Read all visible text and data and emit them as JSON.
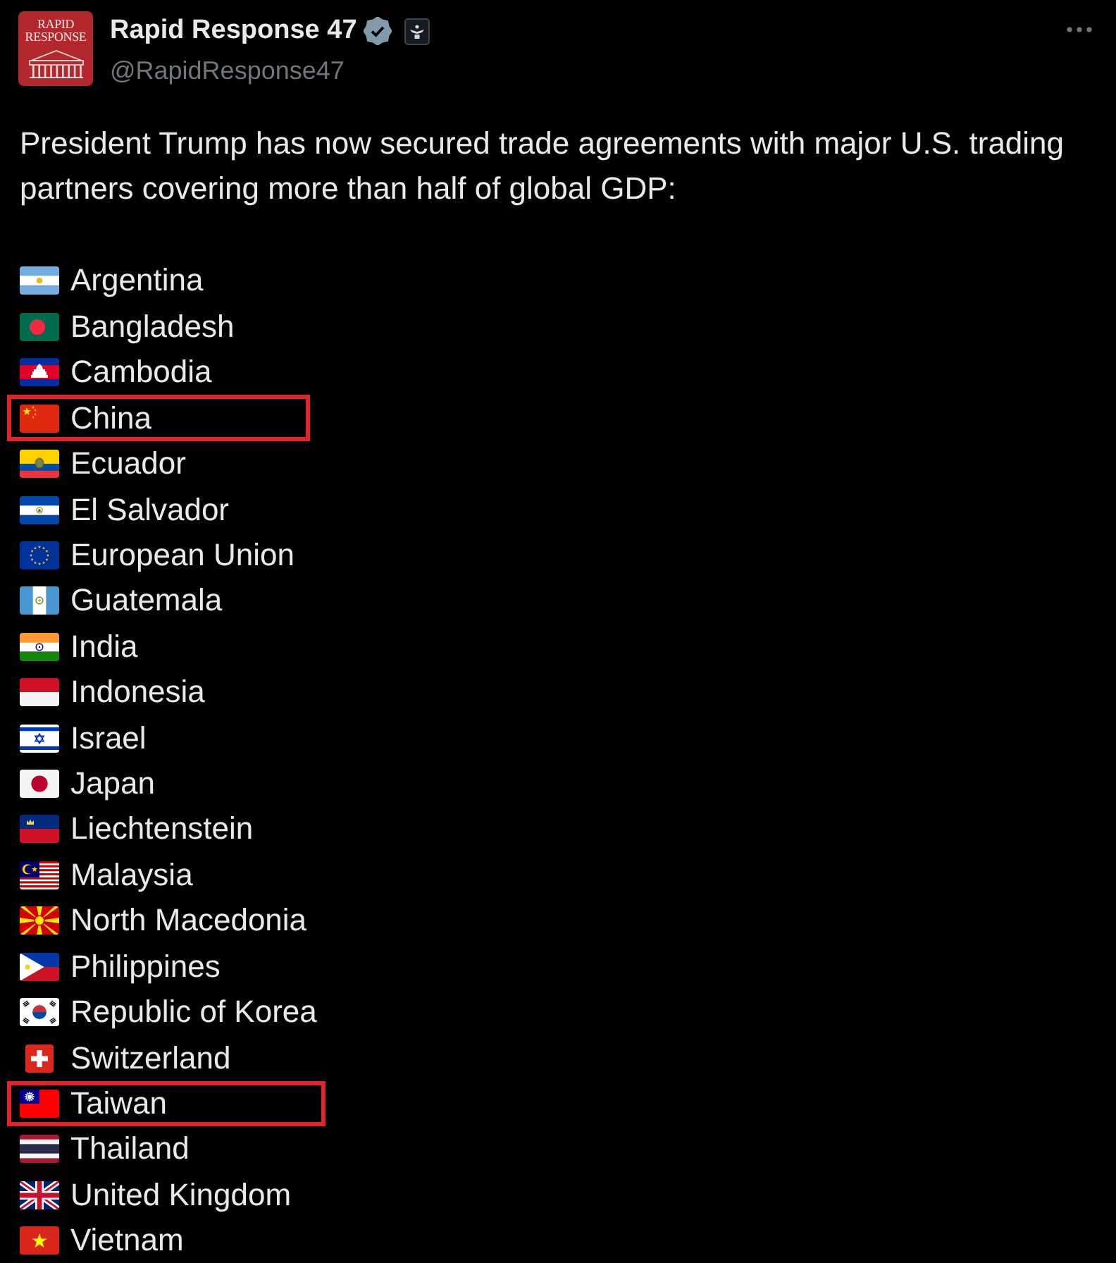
{
  "post": {
    "author": {
      "logo_text": "RAPID RESPONSE",
      "name": "Rapid Response 47",
      "verified": true,
      "handle": "@RapidResponse47"
    },
    "text": "President Trump has now secured trade agreements with major U.S. trading partners covering more than half of global GDP:",
    "countries": [
      {
        "name": "Argentina",
        "highlighted": false
      },
      {
        "name": "Bangladesh",
        "highlighted": false
      },
      {
        "name": "Cambodia",
        "highlighted": false
      },
      {
        "name": "China",
        "highlighted": true
      },
      {
        "name": "Ecuador",
        "highlighted": false
      },
      {
        "name": "El Salvador",
        "highlighted": false
      },
      {
        "name": "European Union",
        "highlighted": false
      },
      {
        "name": "Guatemala",
        "highlighted": false
      },
      {
        "name": "India",
        "highlighted": false
      },
      {
        "name": "Indonesia",
        "highlighted": false
      },
      {
        "name": "Israel",
        "highlighted": false
      },
      {
        "name": "Japan",
        "highlighted": false
      },
      {
        "name": "Liechtenstein",
        "highlighted": false
      },
      {
        "name": "Malaysia",
        "highlighted": false
      },
      {
        "name": "North Macedonia",
        "highlighted": false
      },
      {
        "name": "Philippines",
        "highlighted": false
      },
      {
        "name": "Republic of Korea",
        "highlighted": false
      },
      {
        "name": "Switzerland",
        "highlighted": false
      },
      {
        "name": "Taiwan",
        "highlighted": true
      },
      {
        "name": "Thailand",
        "highlighted": false
      },
      {
        "name": "United Kingdom",
        "highlighted": false
      },
      {
        "name": "Vietnam",
        "highlighted": false
      }
    ]
  }
}
